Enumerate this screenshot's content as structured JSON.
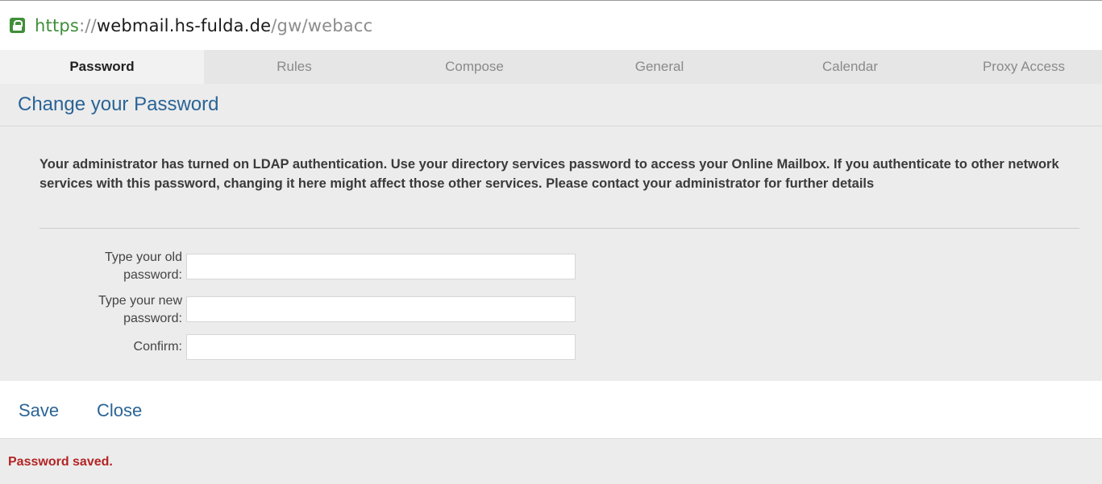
{
  "browser": {
    "url_scheme": "https",
    "url_separator": "://",
    "url_host": "webmail.hs-fulda.de",
    "url_path": "/gw/webacc",
    "icon": "lock-icon"
  },
  "tabs": [
    {
      "label": "Password",
      "active": true
    },
    {
      "label": "Rules",
      "active": false
    },
    {
      "label": "Compose",
      "active": false
    },
    {
      "label": "General",
      "active": false
    },
    {
      "label": "Calendar",
      "active": false
    },
    {
      "label": "Proxy Access",
      "active": false
    }
  ],
  "page": {
    "title": "Change your Password",
    "notice": "Your administrator has turned on LDAP authentication. Use your directory services password to access your Online Mailbox. If you authenticate to other network services with this password, changing it here might affect those other services. Please contact your administrator for further details"
  },
  "form": {
    "old_password_label": "Type your old password:",
    "new_password_label": "Type your new password:",
    "confirm_label": "Confirm:",
    "old_password_value": "",
    "new_password_value": "",
    "confirm_value": ""
  },
  "actions": {
    "save_label": "Save",
    "close_label": "Close"
  },
  "status": {
    "message": "Password saved."
  },
  "colors": {
    "link": "#2a6496",
    "secure": "#3f8f3a",
    "status_error": "#b32424",
    "panel_bg": "#ececec"
  }
}
